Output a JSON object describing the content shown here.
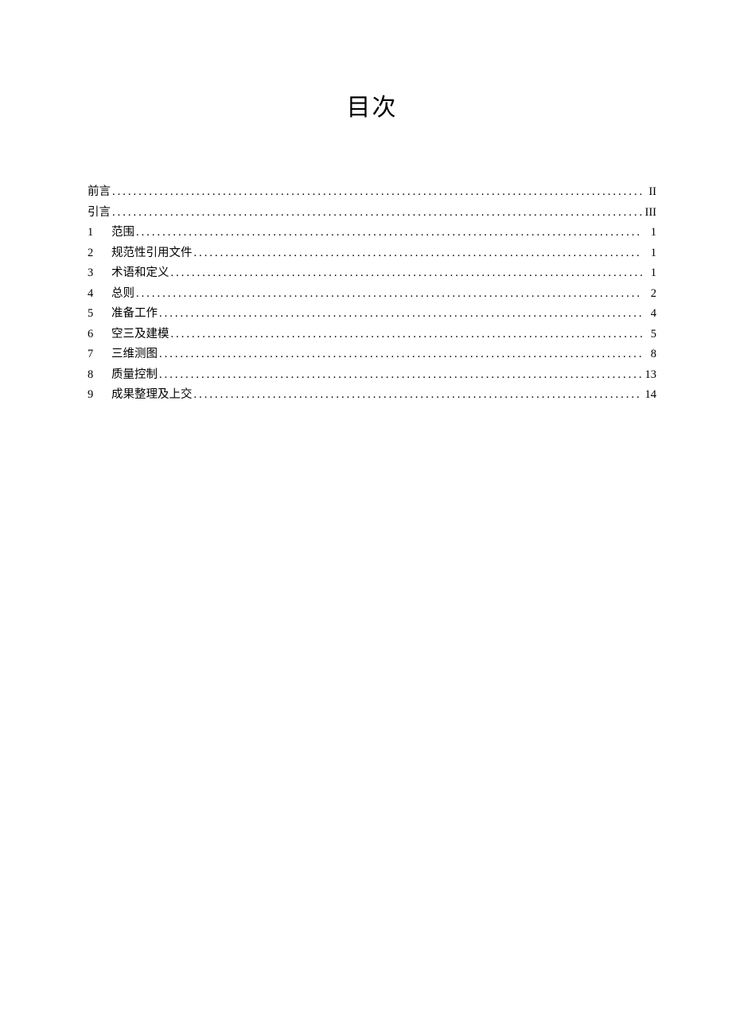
{
  "title": "目次",
  "toc": [
    {
      "num": "",
      "label": "前言",
      "page": "II"
    },
    {
      "num": "",
      "label": "引言",
      "page": "III"
    },
    {
      "num": "1",
      "label": "范围",
      "page": "1"
    },
    {
      "num": "2",
      "label": "规范性引用文件",
      "page": "1"
    },
    {
      "num": "3",
      "label": "术语和定义",
      "page": "1"
    },
    {
      "num": "4",
      "label": "总则",
      "page": "2"
    },
    {
      "num": "5",
      "label": "准备工作",
      "page": "4"
    },
    {
      "num": "6",
      "label": "空三及建模",
      "page": "5"
    },
    {
      "num": "7",
      "label": "三维测图",
      "page": "8"
    },
    {
      "num": "8",
      "label": "质量控制",
      "page": "13"
    },
    {
      "num": "9",
      "label": "成果整理及上交",
      "page": "14"
    }
  ]
}
